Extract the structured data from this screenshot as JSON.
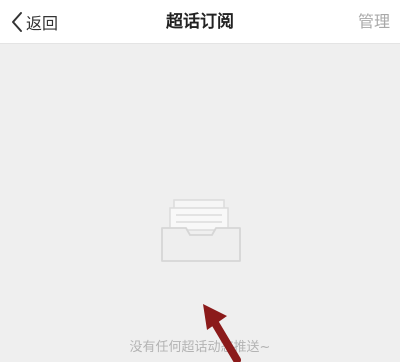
{
  "nav": {
    "back_label": "返回",
    "title": "超话订阅",
    "manage_label": "管理"
  },
  "empty_state": {
    "message": "没有任何超话动态推送~",
    "icon": "inbox-tray-icon"
  },
  "colors": {
    "nav_background": "#ffffff",
    "page_background": "#efefef",
    "manage_text": "#a9a9a9",
    "empty_text": "#b3b3b3",
    "annotation_arrow": "#8b1a1a"
  }
}
